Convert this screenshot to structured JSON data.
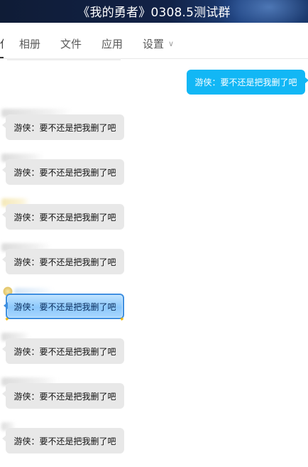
{
  "window": {
    "title": "《我的勇者》0308.5测试群"
  },
  "tabs": {
    "partial_label": "仨",
    "items": [
      {
        "label": "相册"
      },
      {
        "label": "文件"
      },
      {
        "label": "应用"
      },
      {
        "label": "设置"
      }
    ]
  },
  "messages": {
    "self": {
      "text": "游侠：要不还是把我删了吧"
    },
    "others": [
      {
        "text": "游侠：要不还是把我删了吧"
      },
      {
        "text": "游侠：要不还是把我删了吧"
      },
      {
        "text": "游侠：要不还是把我删了吧"
      },
      {
        "text": "游侠：要不还是把我删了吧"
      },
      {
        "text": "游侠：要不还是把我删了吧",
        "style": "special"
      },
      {
        "text": "游侠：要不还是把我删了吧"
      },
      {
        "text": "游侠：要不还是把我删了吧"
      },
      {
        "text": "游侠：要不还是把我删了吧"
      }
    ]
  },
  "colors": {
    "self_bubble": "#12b7f5",
    "other_bubble": "#e8e8e8",
    "special_bubble_border": "#3f8fe0",
    "titlebar": "#122247"
  },
  "icons": {
    "settings_dropdown": "chevron-down-icon"
  }
}
